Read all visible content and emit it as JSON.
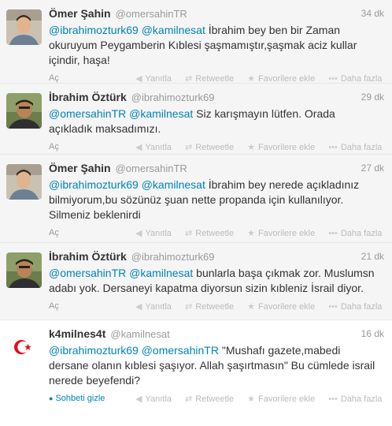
{
  "tweets": [
    {
      "fullname": "Ömer Şahin",
      "username": "@omersahinTR",
      "time": "34 dk",
      "m1": "@ibrahimozturk69",
      "m2": "@kamilnesat",
      "text": " İbrahim bey ben bir Zaman okuruyum Peygamberin Kıblesi şaşmamıştır,şaşmak aciz kullar içindir, haşa!",
      "expand": "Aç"
    },
    {
      "fullname": "İbrahim Öztürk",
      "username": "@ibrahimozturk69",
      "time": "29 dk",
      "m1": "@omersahinTR",
      "m2": "@kamilnesat",
      "text": " Siz karışmayın lütfen. Orada açıkladık maksadımızı.",
      "expand": "Aç"
    },
    {
      "fullname": "Ömer Şahin",
      "username": "@omersahinTR",
      "time": "27 dk",
      "m1": "@ibrahimozturk69",
      "m2": "@kamilnesat",
      "text": " İbrahim bey nerede açıkladınız bilmiyorum,bu sözünüz şuan nette propanda için kullanılıyor. Silmeniz beklenirdi",
      "expand": "Aç"
    },
    {
      "fullname": "İbrahim Öztürk",
      "username": "@ibrahimozturk69",
      "time": "21 dk",
      "m1": "@omersahinTR",
      "m2": "@kamilnesat",
      "text": " bunlarla başa çıkmak zor. Muslumsn adabı yok. Dersaneyi kapatma diyorsun sizin kıbleniz İsrail diyor.",
      "expand": "Aç"
    },
    {
      "fullname": "k4milnes4t",
      "username": "@kamilnesat",
      "time": "16 dk",
      "m1": "@ibrahimozturk69",
      "m2": "@omersahinTR",
      "text": "  \"Mushafı gazete,mabedi dersane olanın kıblesi şaşıyor. Allah şaşırtmasın\" Bu cümlede israil nerede beyefendi?",
      "expand": "Sohbeti gizle"
    }
  ],
  "actions": {
    "reply": "Yanıtla",
    "retweet": "Retweetle",
    "favorite": "Favorilere ekle",
    "more": "Daha fazla"
  },
  "icons": {
    "reply": "reply-arrow-icon",
    "retweet": "retweet-icon",
    "favorite": "star-icon",
    "more": "ellipsis-icon",
    "conversation": "chat-bubble-icon",
    "avatar_k4milnes4t": "turkish-flag-icon"
  },
  "colors": {
    "link": "#0084b4",
    "muted": "#999999",
    "flag_red": "#e30a17"
  }
}
